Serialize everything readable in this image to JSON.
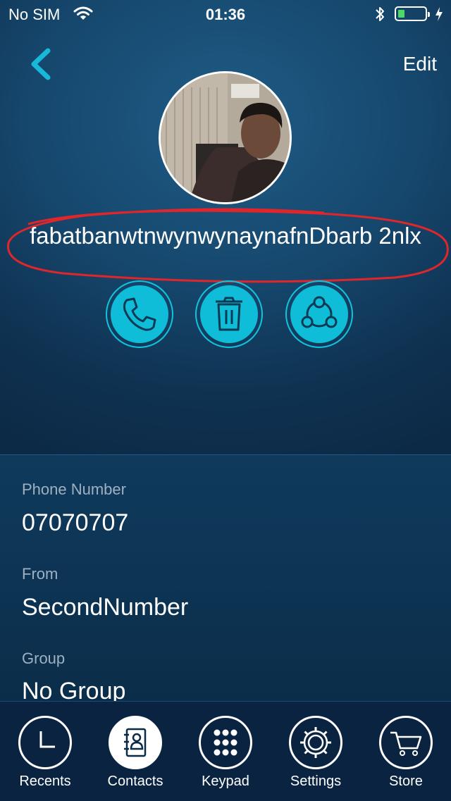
{
  "status_bar": {
    "carrier": "No SIM",
    "time": "01:36",
    "battery_level": 0.25
  },
  "header": {
    "edit_label": "Edit"
  },
  "contact": {
    "name": "fabatbanwtnwynwynaynafnDbarb 2nlx"
  },
  "actions": [
    {
      "icon": "phone-icon"
    },
    {
      "icon": "trash-icon"
    },
    {
      "icon": "share-icon"
    }
  ],
  "details": {
    "phone_label": "Phone Number",
    "phone_value": "07070707",
    "from_label": "From",
    "from_value": "SecondNumber",
    "group_label": "Group",
    "group_value": "No Group"
  },
  "tabs": [
    {
      "label": "Recents",
      "icon": "clock-icon"
    },
    {
      "label": "Contacts",
      "icon": "contacts-book-icon",
      "active": true
    },
    {
      "label": "Keypad",
      "icon": "keypad-icon"
    },
    {
      "label": "Settings",
      "icon": "gear-icon"
    },
    {
      "label": "Store",
      "icon": "cart-icon"
    }
  ],
  "colors": {
    "accent": "#0fbdd8",
    "annotation": "#e0262b"
  }
}
